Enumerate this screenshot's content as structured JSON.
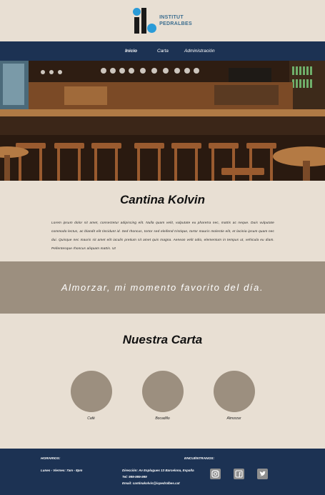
{
  "logo": {
    "line1": "INSTITUT",
    "line2": "PEDRALBES"
  },
  "nav": {
    "items": [
      {
        "label": "Inicio",
        "active": true
      },
      {
        "label": "Carta",
        "active": false
      },
      {
        "label": "Administración",
        "active": false
      }
    ]
  },
  "intro": {
    "title": "Cantina Kolvin",
    "body": "Lorem ipsum dolor sit amet, consectetur adipiscing elit. Nulla quam velit, vulputate eu pharetra nec, mattis ac neque. Duis vulputate commodo lectus, ac blandit elit tincidunt id. Sed rhoncus, tortor sed eleifend tristique, tortor mauris molestie elit, et lacinia ipsum quam nec dui. Quisque nec mauris sit amet elit iaculis pretium sit amet quis magna. Aenean velit odio, elementum in tempus ut, vehicula eu diam. Pellentesque rhoncus aliquam mattis. Ut"
  },
  "quote": {
    "text": "Almorzar, mi momento favorito del día."
  },
  "menu": {
    "title": "Nuestra Carta",
    "items": [
      {
        "label": "Café"
      },
      {
        "label": "Bocadillo"
      },
      {
        "label": "Almorzar"
      }
    ]
  },
  "footer": {
    "hours_title": "HORARIOS:",
    "hours_text": "Lunes - Viernes: 7am - 8pm",
    "contact_title": "ENCUÉNTRANOS:",
    "address": "Dirección: Av Esplugues 13 Barcelona, España",
    "phone": "Tel: 999-999-999",
    "email": "Email: cantinakolvin@ispedralbes.cat",
    "social": [
      "instagram-icon",
      "facebook-icon",
      "twitter-icon"
    ]
  },
  "colors": {
    "nav_bg": "#1c3253",
    "page_bg": "#e8dfd3",
    "accent_taupe": "#9c8f7f",
    "logo_blue": "#2a9bd8"
  }
}
